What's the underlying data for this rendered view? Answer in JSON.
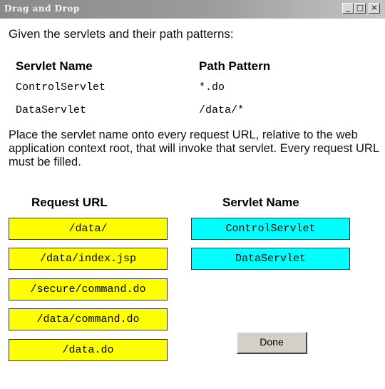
{
  "window": {
    "title": "Drag and Drop",
    "min_glyph": "_",
    "max_glyph": "□",
    "close_glyph": "×"
  },
  "intro": "Given the servlets and their path patterns:",
  "servlet_table": {
    "headers": {
      "name": "Servlet Name",
      "pattern": "Path Pattern"
    },
    "rows": [
      {
        "name": "ControlServlet",
        "pattern": "*.do"
      },
      {
        "name": "DataServlet",
        "pattern": "/data/*"
      }
    ]
  },
  "instructions": "Place the servlet name onto every request URL, relative to the web application context root, that will invoke that servlet. Every request URL must be filled.",
  "request_url_header": "Request URL",
  "servlet_name_header": "Servlet Name",
  "request_urls": [
    "/data/",
    "/data/index.jsp",
    "/secure/command.do",
    "/data/command.do",
    "/data.do"
  ],
  "servlet_options": [
    "ControlServlet",
    "DataServlet"
  ],
  "done_label": "Done",
  "colors": {
    "request_url_box": "#ffff00",
    "servlet_box": "#00ffff",
    "titlebar": "#9c9c9c"
  }
}
